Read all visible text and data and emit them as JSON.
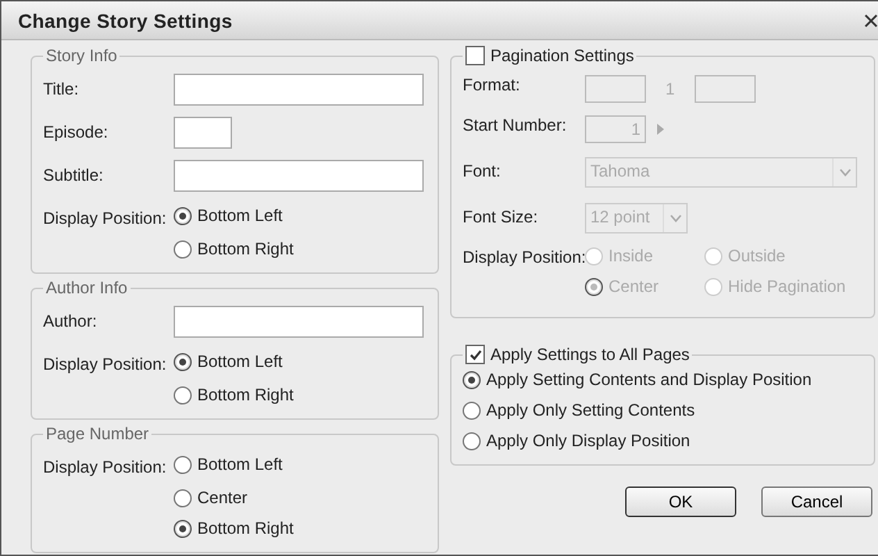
{
  "window": {
    "title": "Change Story Settings"
  },
  "story_info": {
    "title": "Story Info",
    "fields": [
      {
        "label": "Title:",
        "kind": "long"
      },
      {
        "label": "Episode:",
        "kind": "short"
      },
      {
        "label": "Subtitle:",
        "kind": "long"
      }
    ],
    "display_position": {
      "label": "Display Position:",
      "options": [
        {
          "label": "Bottom Left",
          "selected": true
        },
        {
          "label": "Bottom Right",
          "selected": false
        }
      ]
    }
  },
  "author_info": {
    "title": "Author Info",
    "fields": [
      {
        "label": "Author:",
        "kind": "long"
      }
    ],
    "display_position": {
      "label": "Display Position:",
      "options": [
        {
          "label": "Bottom Left",
          "selected": true
        },
        {
          "label": "Bottom Right",
          "selected": false
        }
      ]
    }
  },
  "page_number": {
    "title": "Page Number",
    "display_position": {
      "label": "Display Position:",
      "options": [
        {
          "label": "Bottom Left",
          "selected": false
        },
        {
          "label": "Center",
          "selected": false
        },
        {
          "label": "Bottom Right",
          "selected": true
        }
      ]
    }
  },
  "pagination": {
    "label": "Pagination Settings",
    "checked": false,
    "format": {
      "label": "Format:",
      "separator": "1"
    },
    "start_number": {
      "label": "Start Number:",
      "value": "1"
    },
    "font": {
      "label": "Font:",
      "value": "Tahoma"
    },
    "font_size": {
      "label": "Font Size:",
      "value": "12 point"
    },
    "display_position": {
      "label": "Display Position:",
      "options": [
        {
          "label": "Inside",
          "selected": false
        },
        {
          "label": "Outside",
          "selected": false
        },
        {
          "label": "Center",
          "selected": true
        },
        {
          "label": "Hide Pagination",
          "selected": false
        }
      ]
    }
  },
  "apply": {
    "label": "Apply Settings to All Pages",
    "checked": true,
    "options": [
      {
        "label": "Apply Setting Contents and Display Position",
        "selected": true
      },
      {
        "label": "Apply Only Setting Contents",
        "selected": false
      },
      {
        "label": "Apply Only Display Position",
        "selected": false
      }
    ]
  },
  "buttons": [
    "OK",
    "Cancel"
  ]
}
